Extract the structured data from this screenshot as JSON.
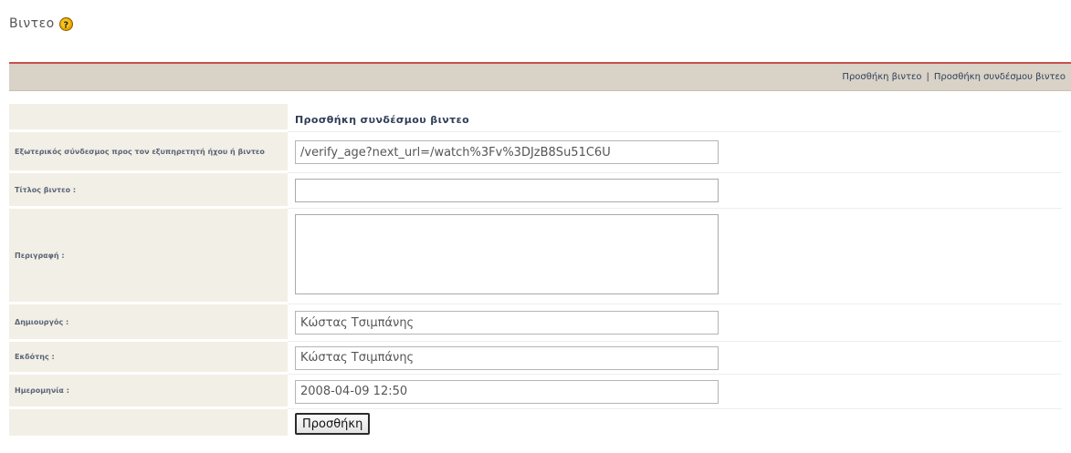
{
  "page": {
    "title": "Βιντεο"
  },
  "toolbar": {
    "add_video_link": "Προσθήκη βιντεο",
    "separator": "|",
    "add_video_link_link": "Προσθήκη συνδέσμου βιντεο"
  },
  "form": {
    "heading": "Προσθήκη συνδέσμου βιντεο",
    "fields": {
      "external_link": {
        "label": "Εξωτερικός σύνδεσμος προς τον εξυπηρετητή ήχου ή βιντεο",
        "value": "/verify_age?next_url=/watch%3Fv%3DJzB8Su51C6U"
      },
      "video_title": {
        "label": "Τίτλος βιντεο :",
        "value": ""
      },
      "description": {
        "label": "Περιγραφή :",
        "value": ""
      },
      "creator": {
        "label": "Δημιουργός :",
        "value": "Κώστας Τσιμπάνης"
      },
      "publisher": {
        "label": "Εκδότης :",
        "value": "Κώστας Τσιμπάνης"
      },
      "date": {
        "label": "Ημερομηνία :",
        "value": "2008-04-09 12:50"
      }
    },
    "submit_label": "Προσθήκη"
  },
  "colors": {
    "toolbar_bg": "#d8d2c7",
    "toolbar_border": "#c9504e",
    "label_bg": "#f2efe6",
    "label_text": "#5b6477",
    "help_icon": "#e8a400"
  },
  "icons": {
    "help": "help-question-icon"
  }
}
